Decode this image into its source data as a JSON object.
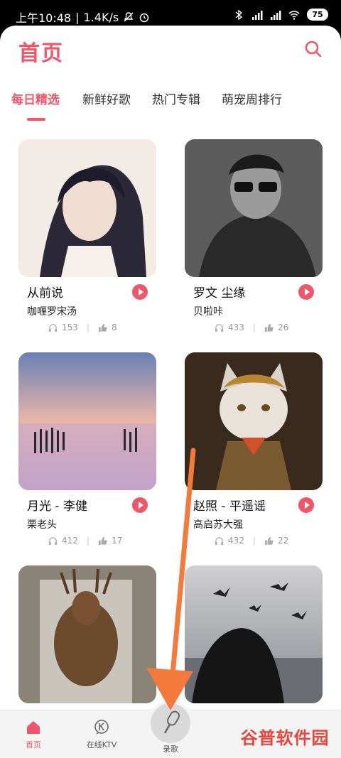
{
  "status_bar": {
    "time": "上午10:48",
    "speed": "1.4K/s",
    "battery": "75"
  },
  "header": {
    "title": "首页",
    "search_icon": "search-icon"
  },
  "tabs": [
    {
      "label": "每日精选",
      "active": true
    },
    {
      "label": "新鲜好歌",
      "active": false
    },
    {
      "label": "热门专辑",
      "active": false
    },
    {
      "label": "萌宠周排行",
      "active": false
    }
  ],
  "cards": [
    {
      "song": "从前说",
      "artist": "咖喱罗宋汤",
      "plays": "153",
      "likes": "8"
    },
    {
      "song": "罗文 尘缘",
      "artist": "贝啦咔",
      "plays": "433",
      "likes": "26"
    },
    {
      "song": "月光 - 李健",
      "artist": "栗老头",
      "plays": "412",
      "likes": "17"
    },
    {
      "song": "赵照 - 平遥谣",
      "artist": "高启苏大强",
      "plays": "432",
      "likes": "22"
    },
    {
      "song": "",
      "artist": "",
      "plays": "",
      "likes": ""
    },
    {
      "song": "",
      "artist": "",
      "plays": "",
      "likes": ""
    }
  ],
  "bottom_nav": {
    "home": "首页",
    "ktv": "在线KTV",
    "record": "录歌"
  },
  "watermark": "谷普软件园",
  "colors": {
    "accent": "#f0566a",
    "arrow": "#f47a3c"
  }
}
